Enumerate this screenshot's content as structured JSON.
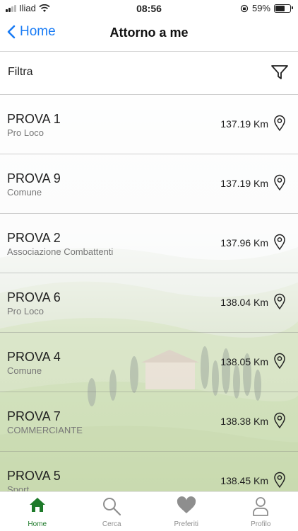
{
  "status_bar": {
    "carrier": "Iliad",
    "time": "08:56",
    "battery": "59%",
    "battery_level": 0.59
  },
  "nav": {
    "back_label": "Home",
    "title": "Attorno a me"
  },
  "filter": {
    "label": "Filtra"
  },
  "items": [
    {
      "name": "PROVA 1",
      "category": "Pro Loco",
      "distance": "137.19 Km"
    },
    {
      "name": "PROVA 9",
      "category": "Comune",
      "distance": "137.19 Km"
    },
    {
      "name": "PROVA 2",
      "category": "Associazione Combattenti",
      "distance": "137.96 Km"
    },
    {
      "name": "PROVA 6",
      "category": "Pro Loco",
      "distance": "138.04 Km"
    },
    {
      "name": "PROVA 4",
      "category": "Comune",
      "distance": "138.05 Km"
    },
    {
      "name": "PROVA 7",
      "category": "COMMERCIANTE",
      "distance": "138.38 Km"
    },
    {
      "name": "PROVA 5",
      "category": "Sport",
      "distance": "138.45 Km"
    }
  ],
  "tabs": [
    {
      "label": "Home",
      "icon": "home-icon",
      "active": true
    },
    {
      "label": "Cerca",
      "icon": "search-icon",
      "active": false
    },
    {
      "label": "Preferiti",
      "icon": "heart-icon",
      "active": false
    },
    {
      "label": "Profilo",
      "icon": "person-icon",
      "active": false
    }
  ],
  "colors": {
    "accent_blue": "#1a7cf5",
    "active_tab_green": "#1e7a2a",
    "inactive_tab": "#8e8e8e"
  }
}
